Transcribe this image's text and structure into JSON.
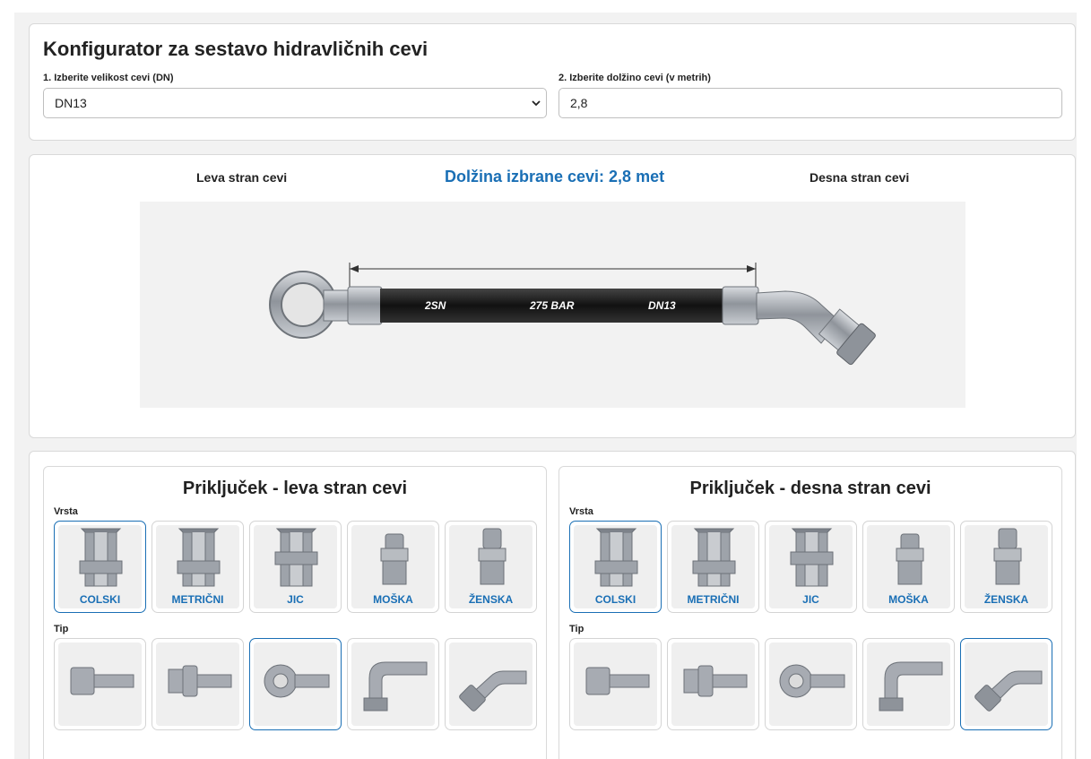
{
  "header": {
    "title": "Konfigurator za sestavo hidravličnih cevi",
    "size_label": "1. Izberite velikost cevi (DN)",
    "size_value": "DN13",
    "length_label": "2. Izberite dolžino cevi (v metrih)",
    "length_value": "2,8"
  },
  "preview": {
    "left_label": "Leva stran cevi",
    "length_text": "Dolžina izbrane cevi: 2,8 met",
    "right_label": "Desna stran cevi",
    "hose_print": [
      "2SN",
      "275 BAR",
      "DN13"
    ]
  },
  "left_panel": {
    "title": "Priključek - leva stran cevi",
    "vrsta_label": "Vrsta",
    "tip_label": "Tip",
    "vrsta": [
      "COLSKI",
      "METRIČNI",
      "JIC",
      "MOŠKA",
      "ŽENSKA"
    ],
    "selected_vrsta": 0,
    "selected_tip": 2
  },
  "right_panel": {
    "title": "Priključek - desna stran cevi",
    "vrsta_label": "Vrsta",
    "tip_label": "Tip",
    "vrsta": [
      "COLSKI",
      "METRIČNI",
      "JIC",
      "MOŠKA",
      "ŽENSKA"
    ],
    "selected_vrsta": 0,
    "selected_tip": 4
  },
  "colors": {
    "accent": "#1a6fb5",
    "hose": "#1b1b1b",
    "metal": "#a9adb4"
  },
  "icons": [
    "chevron-down-icon",
    "banjo-fitting-icon",
    "elbow-45-fitting-icon"
  ]
}
